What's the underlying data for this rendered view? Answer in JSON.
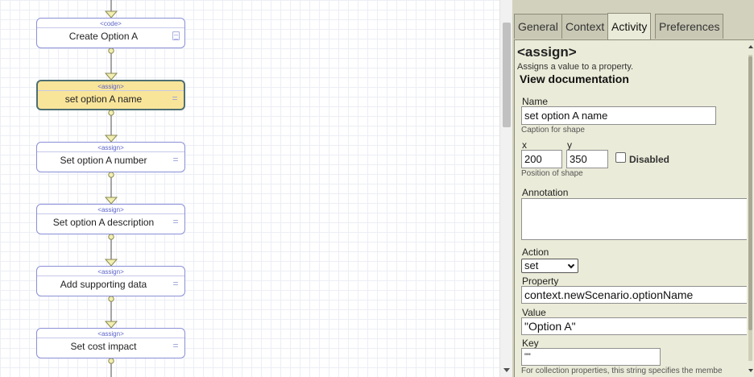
{
  "canvas": {
    "shapes": [
      {
        "type": "<code>",
        "caption": "Create Option A",
        "icon": "document-icon"
      },
      {
        "type": "<assign>",
        "caption": "set option A name",
        "icon": "equals-icon",
        "selected": true
      },
      {
        "type": "<assign>",
        "caption": "Set option A number",
        "icon": "equals-icon"
      },
      {
        "type": "<assign>",
        "caption": "Set option A description",
        "icon": "equals-icon"
      },
      {
        "type": "<assign>",
        "caption": "Add supporting data",
        "icon": "equals-icon"
      },
      {
        "type": "<assign>",
        "caption": "Set cost impact",
        "icon": "equals-icon"
      }
    ]
  },
  "panel": {
    "tabs": [
      "General",
      "Context",
      "Activity",
      "Preferences"
    ],
    "active_tab": "Activity",
    "heading": "<assign>",
    "description": "Assigns a value to a property.",
    "doc_link": "View documentation",
    "name": {
      "label": "Name",
      "value": "set option A name",
      "hint": "Caption for shape"
    },
    "position": {
      "x_label": "x",
      "y_label": "y",
      "x": "200",
      "y": "350",
      "hint": "Position of shape"
    },
    "disabled_label": "Disabled",
    "annotation_label": "Annotation",
    "action": {
      "label": "Action",
      "value": "set"
    },
    "property": {
      "label": "Property",
      "value": "context.newScenario.optionName"
    },
    "value": {
      "label": "Value",
      "value": "\"Option A\""
    },
    "key": {
      "label": "Key",
      "value": "\"\"",
      "hint": "For collection properties, this string specifies the membe"
    }
  },
  "colors": {
    "shape_border": "#8a8fd6",
    "selected_fill": "#f9e59a",
    "selected_border": "#4e6f72",
    "connector": "#6b6b6b",
    "arrow_fill": "#f3efb0",
    "panel_bg": "#ebebd9"
  }
}
